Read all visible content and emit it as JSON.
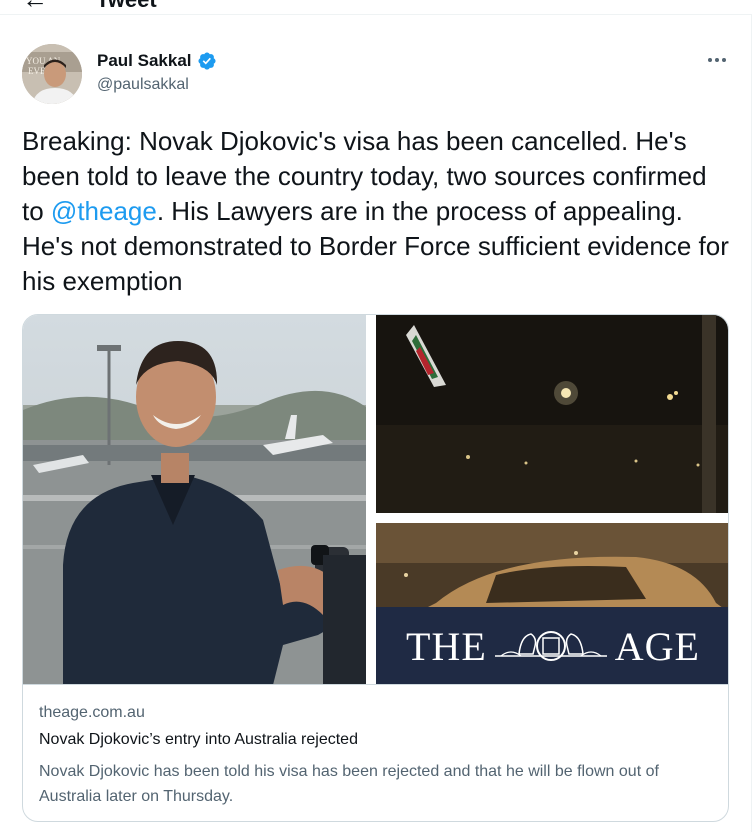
{
  "header": {
    "back_icon": "arrow-left-icon",
    "title": "Tweet"
  },
  "author": {
    "name": "Paul Sakkal",
    "handle": "@paulsakkal",
    "verified": true,
    "verified_color": "#1d9bf0"
  },
  "tweet": {
    "text_before_mention": "Breaking: Novak Djokovic's visa has been cancelled. He's been told to leave the country today, two sources confirmed to ",
    "mention": "@theage",
    "text_after_mention": ". His Lawyers are in the process of appealing. He's not demonstrated to Border Force sufficient evidence for his exemption",
    "mention_color": "#1d9bf0"
  },
  "card": {
    "domain": "theage.com.au",
    "title": "Novak Djokovic’s entry into Australia rejected",
    "description": "Novak Djokovic has been told his visa has been rejected and that he will be flown out of Australia later on Thursday.",
    "banner": {
      "left_word": "THE",
      "right_word": "AGE"
    }
  },
  "colors": {
    "text": "#0f1419",
    "secondary_text": "#536471",
    "border": "#cfd9de",
    "banner_bg": "#1f2a44"
  }
}
